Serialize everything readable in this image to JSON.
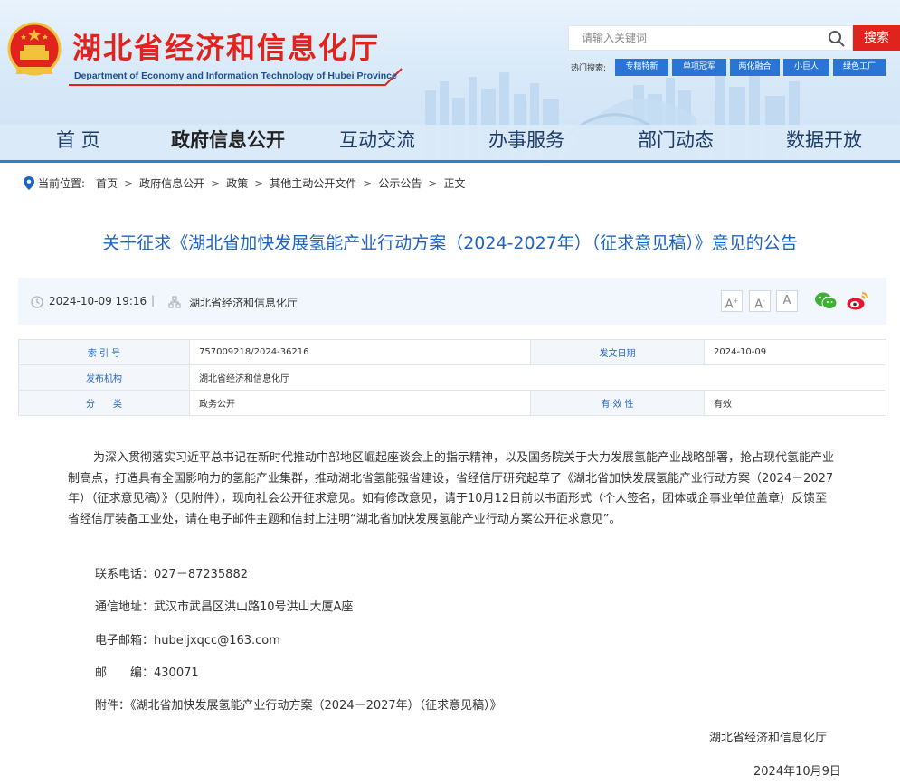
{
  "header": {
    "site_title": "湖北省经济和信息化厅",
    "site_subtitle": "Department of Economy and Information Technology of Hubei Province",
    "search_placeholder": "请输入关键词",
    "search_button": "搜索",
    "hot_label": "热门搜索:",
    "hot_tags": [
      "专精特新",
      "单项冠军",
      "两化融合",
      "小巨人",
      "绿色工厂"
    ],
    "brand_color": "#e0231c",
    "accent_color": "#2a74d6"
  },
  "nav": {
    "items": [
      "首 页",
      "政府信息公开",
      "互动交流",
      "办事服务",
      "部门动态",
      "数据开放"
    ],
    "active_index": 1
  },
  "breadcrumb": {
    "label": "当前位置:",
    "items": [
      "首页",
      "政府信息公开",
      "政策",
      "其他主动公开文件",
      "公示公告",
      "正文"
    ],
    "separator": ">"
  },
  "article": {
    "title": "关于征求《湖北省加快发展氢能产业行动方案（2024-2027年）（征求意见稿）》意见的公告",
    "date": "2024-10-09 19:16",
    "meta_divider": "|",
    "source": "湖北省经济和信息化厅",
    "font_sizes": [
      "A",
      "A",
      "A"
    ],
    "share_icons": [
      "wechat-icon",
      "weibo-icon"
    ]
  },
  "info_table": {
    "index_label": "索 引 号",
    "index_value": "757009218/2024-36216",
    "issue_date_label": "发文日期",
    "issue_date_value": "2024-10-09",
    "publisher_label": "发布机构",
    "publisher_value": "湖北省经济和信息化厅",
    "category_label": "分　　类",
    "category_value": "政务公开",
    "validity_label": "有 效 性",
    "validity_value": "有效"
  },
  "body": {
    "paragraph": "为深入贯彻落实习近平总书记在新时代推动中部地区崛起座谈会上的指示精神，以及国务院关于大力发展氢能产业战略部署，抢占现代氢能产业制高点，打造具有全国影响力的氢能产业集群，推动湖北省氢能强省建设，省经信厅研究起草了《湖北省加快发展氢能产业行动方案（2024－2027年）（征求意见稿）》（见附件），现向社会公开征求意见。如有修改意见，请于10月12日前以书面形式（个人签名，团体或企事业单位盖章）反馈至省经信厅装备工业处，请在电子邮件主题和信封上注明“湖北省加快发展氢能产业行动方案公开征求意见”。",
    "phone": "联系电话：027－87235882",
    "address": "通信地址：武汉市武昌区洪山路10号洪山大厦A座",
    "email": "电子邮箱：hubeijxqcc@163.com",
    "postcode": "邮　　编：430071",
    "attachment": "附件：《湖北省加快发展氢能产业行动方案（2024－2027年）（征求意见稿）》",
    "signature": "湖北省经济和信息化厅",
    "sign_date": "2024年10月9日"
  }
}
